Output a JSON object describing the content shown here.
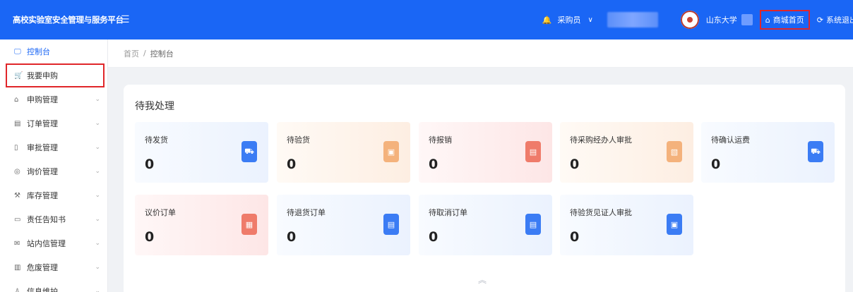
{
  "header": {
    "title": "高校实验室安全管理与服务平台",
    "menu_icon": "menu-fold-icon",
    "role": "采购员",
    "role_caret": "∨",
    "university": "山东大学",
    "home_link": "商城首页",
    "logout": "系统退出",
    "brand_color": "#1a66f5"
  },
  "sidebar": {
    "items": [
      {
        "label": "控制台",
        "icon": "monitor-icon",
        "glyph": "🖵",
        "caret": ""
      },
      {
        "label": "我要申购",
        "icon": "cart-icon",
        "glyph": "🛒",
        "caret": ""
      },
      {
        "label": "申购管理",
        "icon": "bag-icon",
        "glyph": "⌂",
        "caret": "⌄"
      },
      {
        "label": "订单管理",
        "icon": "list-icon",
        "glyph": "▤",
        "caret": "⌄"
      },
      {
        "label": "审批管理",
        "icon": "approve-icon",
        "glyph": "▯",
        "caret": "⌄"
      },
      {
        "label": "询价管理",
        "icon": "inquiry-icon",
        "glyph": "◎",
        "caret": "⌄"
      },
      {
        "label": "库存管理",
        "icon": "warehouse-icon",
        "glyph": "⚒",
        "caret": "⌄"
      },
      {
        "label": "责任告知书",
        "icon": "document-icon",
        "glyph": "▭",
        "caret": "⌄"
      },
      {
        "label": "站内信管理",
        "icon": "mail-icon",
        "glyph": "✉",
        "caret": "⌄"
      },
      {
        "label": "危废管理",
        "icon": "bin-icon",
        "glyph": "▥",
        "caret": "⌄"
      },
      {
        "label": "信息维护",
        "icon": "user-icon",
        "glyph": "♙",
        "caret": "⌄"
      }
    ]
  },
  "breadcrumb": {
    "home": "首页",
    "sep": "/",
    "current": "控制台"
  },
  "pending": {
    "title": "待我处理",
    "tiles": [
      {
        "label": "待发货",
        "value": "0",
        "icon": "truck-icon",
        "glyph": "⛟"
      },
      {
        "label": "待验货",
        "value": "0",
        "icon": "inspect-icon",
        "glyph": "▣"
      },
      {
        "label": "待报销",
        "value": "0",
        "icon": "reimburse-icon",
        "glyph": "▤"
      },
      {
        "label": "待采购经办人审批",
        "value": "0",
        "icon": "approval-icon",
        "glyph": "▧"
      },
      {
        "label": "待确认运费",
        "value": "0",
        "icon": "freight-icon",
        "glyph": "⛟"
      },
      {
        "label": "议价订单",
        "value": "0",
        "icon": "bargain-icon",
        "glyph": "▦"
      },
      {
        "label": "待退货订单",
        "value": "0",
        "icon": "return-icon",
        "glyph": "▤"
      },
      {
        "label": "待取消订单",
        "value": "0",
        "icon": "cancel-icon",
        "glyph": "▤"
      },
      {
        "label": "待验货见证人审批",
        "value": "0",
        "icon": "witness-icon",
        "glyph": "▣"
      }
    ],
    "scroll_glyph": "︽"
  }
}
